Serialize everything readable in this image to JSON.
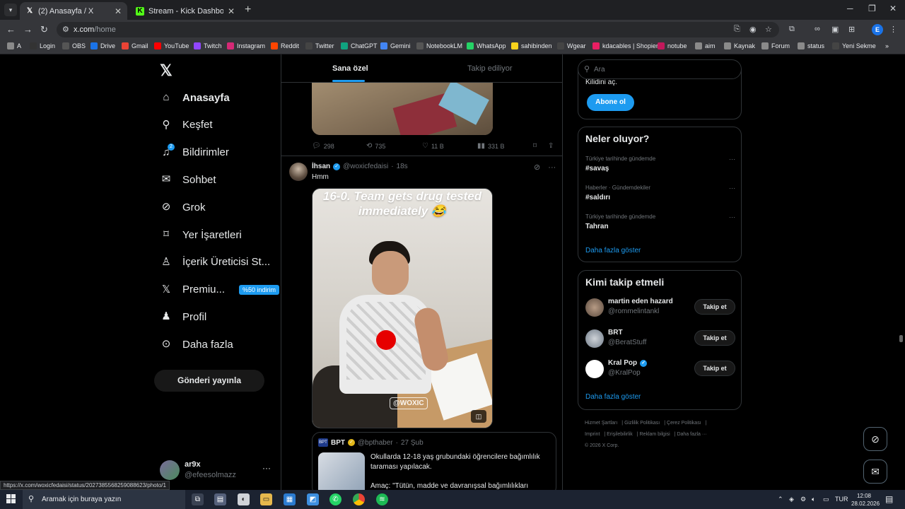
{
  "browser": {
    "tabs": [
      {
        "title": "(2) Anasayfa / X",
        "favicon": "X",
        "active": true
      },
      {
        "title": "Stream - Kick Dashboard",
        "favicon": "K",
        "active": false
      }
    ],
    "url_host": "x.com",
    "url_path": "/home",
    "bookmarks": [
      "A",
      "Login",
      "OBS",
      "Drive",
      "Gmail",
      "YouTube",
      "Twitch",
      "Instagram",
      "Reddit",
      "Twitter",
      "ChatGPT",
      "Gemini",
      "NotebookLM",
      "WhatsApp",
      "sahibinden",
      "Wgear",
      "kdacables | Shopier",
      "notube",
      "aim",
      "Kaynak",
      "Forum",
      "status",
      "Yeni Sekme"
    ],
    "profile_letter": "E",
    "status_url": "https://x.com/woxicfedaisi/status/2027385568259088623/photo/1"
  },
  "nav": {
    "items": [
      {
        "label": "Anasayfa",
        "icon": "home-icon"
      },
      {
        "label": "Keşfet",
        "icon": "search-icon"
      },
      {
        "label": "Bildirimler",
        "icon": "bell-icon",
        "badge": "2"
      },
      {
        "label": "Sohbet",
        "icon": "mail-icon"
      },
      {
        "label": "Grok",
        "icon": "grok-icon"
      },
      {
        "label": "Yer İşaretleri",
        "icon": "bookmark-icon"
      },
      {
        "label": "İçerik Üreticisi St...",
        "icon": "creator-studio-icon"
      },
      {
        "label": "Premiu...",
        "icon": "x-icon",
        "promo": "%50 indirim"
      },
      {
        "label": "Profil",
        "icon": "person-icon"
      },
      {
        "label": "Daha fazla",
        "icon": "more-circle-icon"
      }
    ],
    "post_button": "Gönderi yayınla",
    "account": {
      "name": "ar9x",
      "handle": "@efeesolmazz"
    }
  },
  "feed": {
    "tabs": [
      "Sana özel",
      "Takip ediliyor"
    ],
    "prev_tweet_actions": {
      "replies": "298",
      "reposts": "735",
      "likes": "11 B",
      "views": "331 B"
    },
    "tweet": {
      "name": "İhsan",
      "handle": "@woxicfedaisi",
      "time": "18s",
      "text": "Hmm",
      "photo_caption": "16-0. Team gets drug tested immediately 😂",
      "photo_tag": "@WOXIC",
      "quote": {
        "logo": "BPT",
        "name": "BPT",
        "handle": "@bpthaber",
        "date": "27 Şub",
        "text": "Okullarda 12-18 yaş grubundaki öğrencilere bağımlılık taraması yapılacak.",
        "text2": "Amaç: \"Tütün, madde ve davranışsal bağımlılıkları"
      }
    }
  },
  "right": {
    "search_placeholder": "Ara",
    "premium_cut_text": "Kilidini aç.",
    "subscribe_button": "Abone ol",
    "trends_title": "Neler oluyor?",
    "trends": [
      {
        "context": "Türkiye tarihinde gündemde",
        "topic": "#savaş"
      },
      {
        "context": "Haberler · Gündemdekiler",
        "topic": "#saldırı"
      },
      {
        "context": "Türkiye tarihinde gündemde",
        "topic": "Tahran"
      }
    ],
    "show_more": "Daha fazla göster",
    "who_title": "Kimi takip etmeli",
    "who": [
      {
        "name": "martin eden hazard",
        "handle": "@rommelintankl",
        "verified": false
      },
      {
        "name": "BRT",
        "handle": "@BeratStuff",
        "verified": false
      },
      {
        "name": "Kral Pop",
        "handle": "@KralPop",
        "verified": true
      }
    ],
    "follow_button": "Takip et",
    "footer_links": [
      "Hizmet Şartları",
      "Gizlilik Politikası",
      "Çerez Politikası",
      "Imprint",
      "Erişilebilirlik",
      "Reklam bilgisi",
      "Daha fazla ···"
    ],
    "copyright": "© 2026 X Corp."
  },
  "taskbar": {
    "search_text": "Aramak için buraya yazın",
    "language": "TUR",
    "time": "12:08",
    "date": "28.02.2026"
  }
}
